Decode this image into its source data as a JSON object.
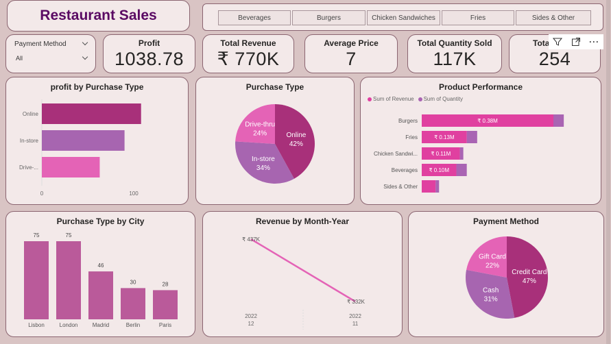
{
  "app": {
    "title": "Restaurant Sales"
  },
  "slicer": {
    "items": [
      "Beverages",
      "Burgers",
      "Chicken Sandwiches",
      "Fries",
      "Sides & Other"
    ]
  },
  "filter": {
    "label": "Payment Method",
    "value": "All"
  },
  "kpis": [
    {
      "label": "Profit",
      "value": "1038.78"
    },
    {
      "label": "Total Revenue",
      "value": "₹ 770K"
    },
    {
      "label": "Average Price",
      "value": "7"
    },
    {
      "label": "Total Quantity Sold",
      "value": "117K"
    },
    {
      "label": "Tota",
      "value": "254"
    }
  ],
  "colors": {
    "primary": "#a8307a",
    "purple": "#a765b0",
    "pink": "#e463b6",
    "magenta": "#e040a0",
    "lightpurple": "#a964b3"
  },
  "visuals": {
    "profit_by_type": {
      "title": "profit by Purchase Type"
    },
    "purchase_type": {
      "title": "Purchase Type"
    },
    "product_performance": {
      "title": "Product Performance",
      "legend": [
        "Sum of Revenue",
        "Sum of Quantity"
      ]
    },
    "type_by_city": {
      "title": "Purchase Type by City"
    },
    "revenue_month": {
      "title": "Revenue by Month-Year"
    },
    "payment_method": {
      "title": "Payment Method"
    }
  },
  "toolbar": {
    "filter_icon": "filter-icon",
    "focus_icon": "focus-mode-icon",
    "more_icon": "more-options-icon"
  },
  "chart_data": [
    {
      "type": "bar",
      "title": "profit by Purchase Type",
      "categories": [
        "Online",
        "In-store",
        "Drive-..."
      ],
      "values": [
        108,
        90,
        63
      ],
      "xticks": [
        "0",
        "100"
      ]
    },
    {
      "type": "pie",
      "title": "Purchase Type",
      "labels": [
        "Online",
        "In-store",
        "Drive-thru"
      ],
      "values": [
        42,
        34,
        24
      ],
      "display": [
        "42%",
        "34%",
        "24%"
      ]
    },
    {
      "type": "bar",
      "title": "Product Performance",
      "categories": [
        "Burgers",
        "Fries",
        "Chicken Sandwi...",
        "Beverages",
        "Sides & Other"
      ],
      "series": [
        {
          "name": "Sum of Revenue",
          "values": [
            0.38,
            0.13,
            0.11,
            0.1,
            0.04
          ],
          "labels": [
            "₹ 0.38M",
            "₹ 0.13M",
            "₹ 0.11M",
            "₹ 0.10M",
            ""
          ]
        },
        {
          "name": "Sum of Quantity",
          "values": [
            0.03,
            0.03,
            0.01,
            0.03,
            0.01
          ]
        }
      ]
    },
    {
      "type": "bar",
      "title": "Purchase Type by City",
      "categories": [
        "Lisbon",
        "London",
        "Madrid",
        "Berlin",
        "Paris"
      ],
      "values": [
        75,
        75,
        46,
        30,
        28
      ]
    },
    {
      "type": "line",
      "title": "Revenue by Month-Year",
      "x": [
        {
          "year": "2022",
          "month": "12"
        },
        {
          "year": "2022",
          "month": "11"
        }
      ],
      "values": [
        437,
        332
      ],
      "labels": [
        "₹ 437K",
        "₹ 332K"
      ]
    },
    {
      "type": "pie",
      "title": "Payment Method",
      "labels": [
        "Credit Card",
        "Cash",
        "Gift Card"
      ],
      "values": [
        47,
        31,
        22
      ],
      "display": [
        "47%",
        "31%",
        "22%"
      ]
    }
  ]
}
